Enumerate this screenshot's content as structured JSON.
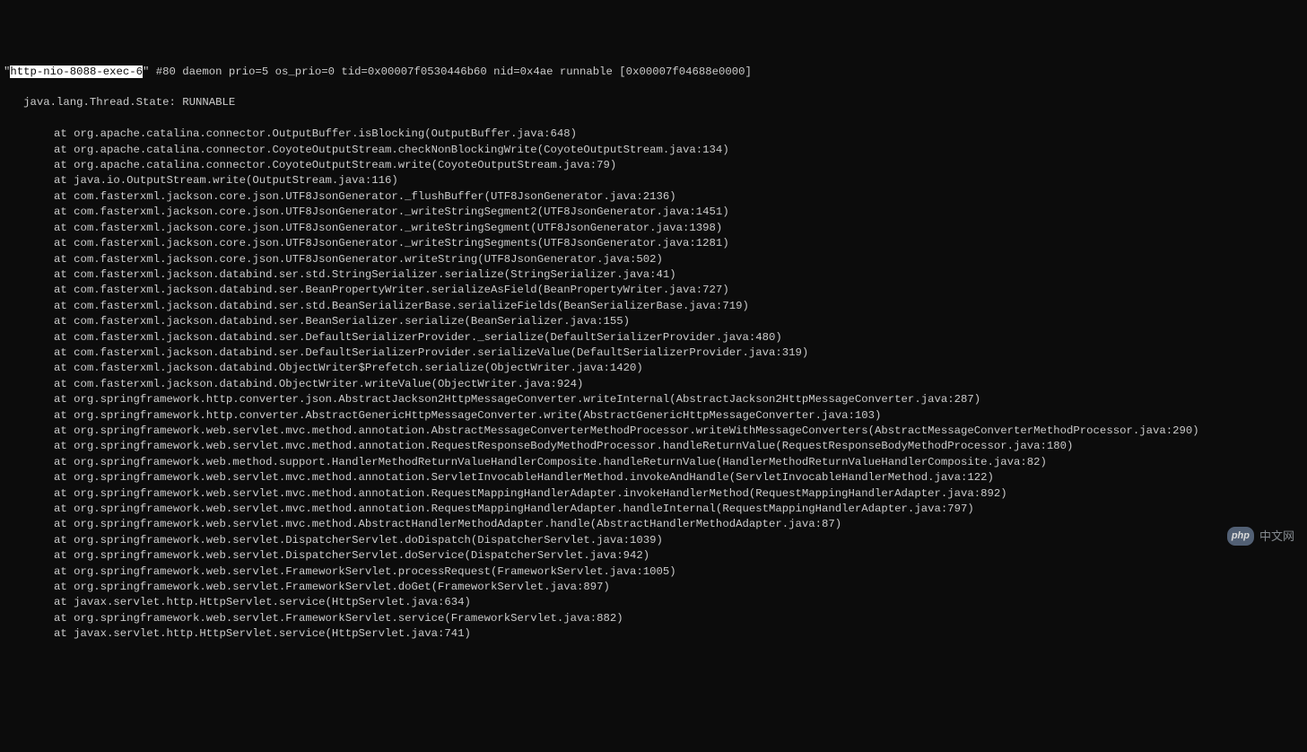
{
  "thread": {
    "quote_open": "\"",
    "name": "http-nio-8088-exec-6",
    "quote_close": "\"",
    "meta": " #80 daemon prio=5 os_prio=0 tid=0x00007f0530446b60 nid=0x4ae runnable [0x00007f04688e0000]"
  },
  "state_line": "   java.lang.Thread.State: RUNNABLE",
  "stack": [
    "at org.apache.catalina.connector.OutputBuffer.isBlocking(OutputBuffer.java:648)",
    "at org.apache.catalina.connector.CoyoteOutputStream.checkNonBlockingWrite(CoyoteOutputStream.java:134)",
    "at org.apache.catalina.connector.CoyoteOutputStream.write(CoyoteOutputStream.java:79)",
    "at java.io.OutputStream.write(OutputStream.java:116)",
    "at com.fasterxml.jackson.core.json.UTF8JsonGenerator._flushBuffer(UTF8JsonGenerator.java:2136)",
    "at com.fasterxml.jackson.core.json.UTF8JsonGenerator._writeStringSegment2(UTF8JsonGenerator.java:1451)",
    "at com.fasterxml.jackson.core.json.UTF8JsonGenerator._writeStringSegment(UTF8JsonGenerator.java:1398)",
    "at com.fasterxml.jackson.core.json.UTF8JsonGenerator._writeStringSegments(UTF8JsonGenerator.java:1281)",
    "at com.fasterxml.jackson.core.json.UTF8JsonGenerator.writeString(UTF8JsonGenerator.java:502)",
    "at com.fasterxml.jackson.databind.ser.std.StringSerializer.serialize(StringSerializer.java:41)",
    "at com.fasterxml.jackson.databind.ser.BeanPropertyWriter.serializeAsField(BeanPropertyWriter.java:727)",
    "at com.fasterxml.jackson.databind.ser.std.BeanSerializerBase.serializeFields(BeanSerializerBase.java:719)",
    "at com.fasterxml.jackson.databind.ser.BeanSerializer.serialize(BeanSerializer.java:155)",
    "at com.fasterxml.jackson.databind.ser.DefaultSerializerProvider._serialize(DefaultSerializerProvider.java:480)",
    "at com.fasterxml.jackson.databind.ser.DefaultSerializerProvider.serializeValue(DefaultSerializerProvider.java:319)",
    "at com.fasterxml.jackson.databind.ObjectWriter$Prefetch.serialize(ObjectWriter.java:1420)",
    "at com.fasterxml.jackson.databind.ObjectWriter.writeValue(ObjectWriter.java:924)",
    "at org.springframework.http.converter.json.AbstractJackson2HttpMessageConverter.writeInternal(AbstractJackson2HttpMessageConverter.java:287)",
    "at org.springframework.http.converter.AbstractGenericHttpMessageConverter.write(AbstractGenericHttpMessageConverter.java:103)",
    "at org.springframework.web.servlet.mvc.method.annotation.AbstractMessageConverterMethodProcessor.writeWithMessageConverters(AbstractMessageConverterMethodProcessor.java:290)",
    "at org.springframework.web.servlet.mvc.method.annotation.RequestResponseBodyMethodProcessor.handleReturnValue(RequestResponseBodyMethodProcessor.java:180)",
    "at org.springframework.web.method.support.HandlerMethodReturnValueHandlerComposite.handleReturnValue(HandlerMethodReturnValueHandlerComposite.java:82)",
    "at org.springframework.web.servlet.mvc.method.annotation.ServletInvocableHandlerMethod.invokeAndHandle(ServletInvocableHandlerMethod.java:122)",
    "at org.springframework.web.servlet.mvc.method.annotation.RequestMappingHandlerAdapter.invokeHandlerMethod(RequestMappingHandlerAdapter.java:892)",
    "at org.springframework.web.servlet.mvc.method.annotation.RequestMappingHandlerAdapter.handleInternal(RequestMappingHandlerAdapter.java:797)",
    "at org.springframework.web.servlet.mvc.method.AbstractHandlerMethodAdapter.handle(AbstractHandlerMethodAdapter.java:87)",
    "at org.springframework.web.servlet.DispatcherServlet.doDispatch(DispatcherServlet.java:1039)",
    "at org.springframework.web.servlet.DispatcherServlet.doService(DispatcherServlet.java:942)",
    "at org.springframework.web.servlet.FrameworkServlet.processRequest(FrameworkServlet.java:1005)",
    "at org.springframework.web.servlet.FrameworkServlet.doGet(FrameworkServlet.java:897)",
    "at javax.servlet.http.HttpServlet.service(HttpServlet.java:634)",
    "at org.springframework.web.servlet.FrameworkServlet.service(FrameworkServlet.java:882)",
    "at javax.servlet.http.HttpServlet.service(HttpServlet.java:741)"
  ],
  "watermark": {
    "badge": "php",
    "text": "中文网"
  }
}
